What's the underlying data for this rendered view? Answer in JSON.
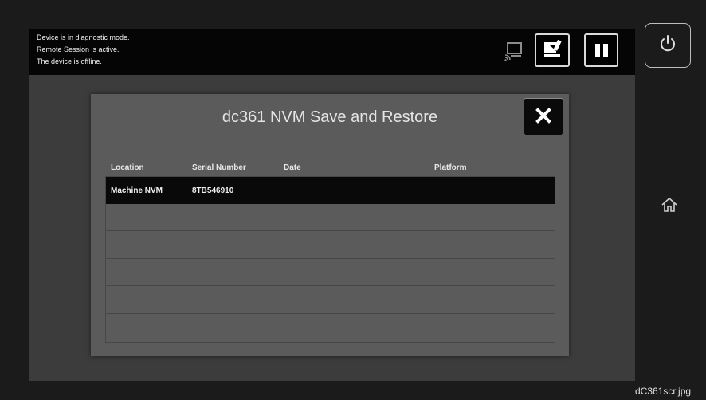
{
  "status": {
    "lines": [
      "Device is in diagnostic mode.",
      "Remote Session is active.",
      "The device is offline."
    ]
  },
  "icons": {
    "remote_session": "remote-session-icon",
    "jobs": "job-status-icon",
    "pause": "pause-icon",
    "power": "power-icon",
    "home": "home-icon",
    "close": "close-icon"
  },
  "dialog": {
    "title": "dc361 NVM Save and Restore",
    "columns": [
      "Location",
      "Serial Number",
      "Date",
      "Platform"
    ],
    "rows": [
      {
        "location": "Machine NVM",
        "serial": "8TB546910",
        "date": "",
        "platform": ""
      },
      {
        "location": "",
        "serial": "",
        "date": "",
        "platform": ""
      },
      {
        "location": "",
        "serial": "",
        "date": "",
        "platform": ""
      },
      {
        "location": "",
        "serial": "",
        "date": "",
        "platform": ""
      },
      {
        "location": "",
        "serial": "",
        "date": "",
        "platform": ""
      },
      {
        "location": "",
        "serial": "",
        "date": "",
        "platform": ""
      }
    ]
  },
  "watermark": "dC361scr.jpg",
  "colors": {
    "background": "#1b1b1b",
    "screen": "#3c3c3c",
    "dialog": "#5b5b5b",
    "selected_row": "#090909",
    "status_bar": "#050505"
  }
}
